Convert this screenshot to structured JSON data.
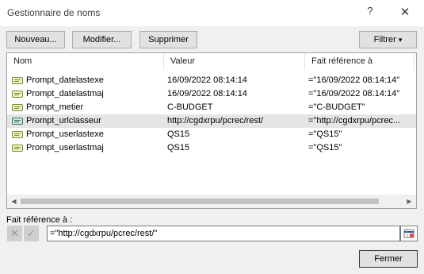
{
  "window": {
    "title": "Gestionnaire de noms",
    "help_glyph": "?",
    "close_glyph": "✕"
  },
  "toolbar": {
    "new_label": "Nouveau...",
    "edit_label": "Modifier...",
    "delete_label": "Supprimer",
    "filter_label": "Filtrer",
    "filter_arrow": "▾"
  },
  "table": {
    "columns": [
      "Nom",
      "Valeur",
      "Fait référence à"
    ],
    "rows": [
      {
        "name": "Prompt_datelastexe",
        "value": "16/09/2022 08:14:14",
        "ref": "=\"16/09/2022 08:14:14\"",
        "selected": false
      },
      {
        "name": "Prompt_datelastmaj",
        "value": "16/09/2022 08:14:14",
        "ref": "=\"16/09/2022 08:14:14\"",
        "selected": false
      },
      {
        "name": "Prompt_metier",
        "value": "C-BUDGET",
        "ref": "=\"C-BUDGET\"",
        "selected": false
      },
      {
        "name": "Prompt_urlclasseur",
        "value": "http://cgdxrpu/pcrec/rest/",
        "ref": "=\"http://cgdxrpu/pcrec...",
        "selected": true
      },
      {
        "name": "Prompt_userlastexe",
        "value": "QS15",
        "ref": "=\"QS15\"",
        "selected": false
      },
      {
        "name": "Prompt_userlastmaj",
        "value": "QS15",
        "ref": "=\"QS15\"",
        "selected": false
      }
    ],
    "scroll_left_glyph": "◀",
    "scroll_right_glyph": "▶"
  },
  "reference": {
    "label": "Fait référence à :",
    "value": "=\"http://cgdxrpu/pcrec/rest/\"",
    "cancel_glyph": "✕",
    "confirm_glyph": "✓"
  },
  "footer": {
    "close_label": "Fermer"
  },
  "colors": {
    "accent": "#0078d7",
    "selection": "#e5e5e5",
    "name_icon_fill": "#f2f2c8",
    "name_icon_stroke": "#7a8a2a",
    "selected_icon_fill": "#c9e4d9",
    "selected_icon_stroke": "#3d7a66"
  },
  "icons": {
    "help": "help-icon",
    "close": "close-icon",
    "name_row": "defined-name-icon",
    "collapse": "collapse-dialog-icon"
  }
}
